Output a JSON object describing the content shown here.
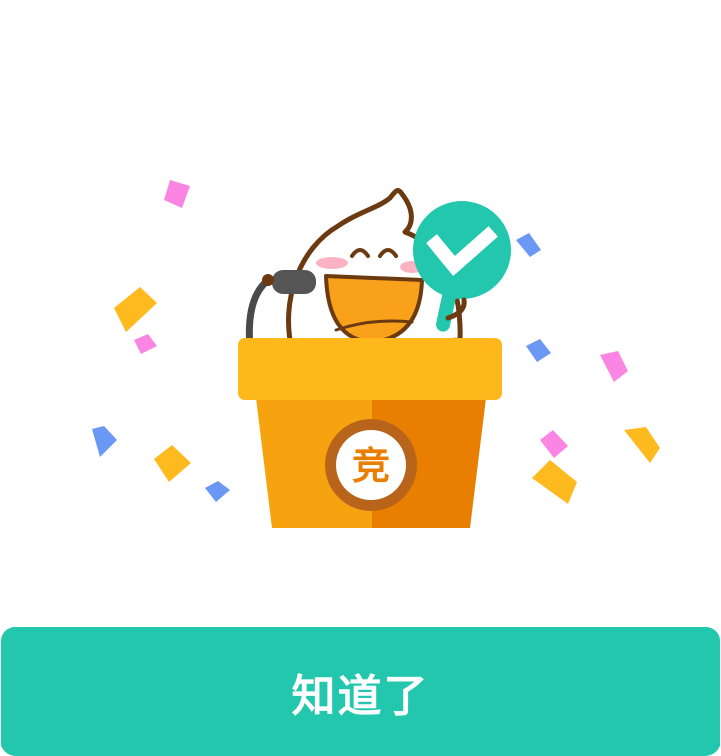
{
  "dialog": {
    "confirm_button_label": "知道了"
  },
  "illustration": {
    "podium_badge_text": "竞",
    "icons": {
      "mascot": "mascot-icon",
      "podium": "podium-icon",
      "microphone": "microphone-icon",
      "checkmark_sign": "checkmark-sign-icon",
      "confetti": "confetti-icon"
    }
  },
  "colors": {
    "accent": "#22c7ad",
    "podium_top": "#ffb81c",
    "podium_left": "#f7a30f",
    "podium_right": "#e97f00",
    "badge_ring": "#b8651b",
    "mascot_outline": "#6b3a10",
    "mascot_mouth": "#f9a11b",
    "confetti_pink": "#fa85e3",
    "confetti_blue": "#6b98f5",
    "confetti_yellow": "#ffba1f"
  }
}
